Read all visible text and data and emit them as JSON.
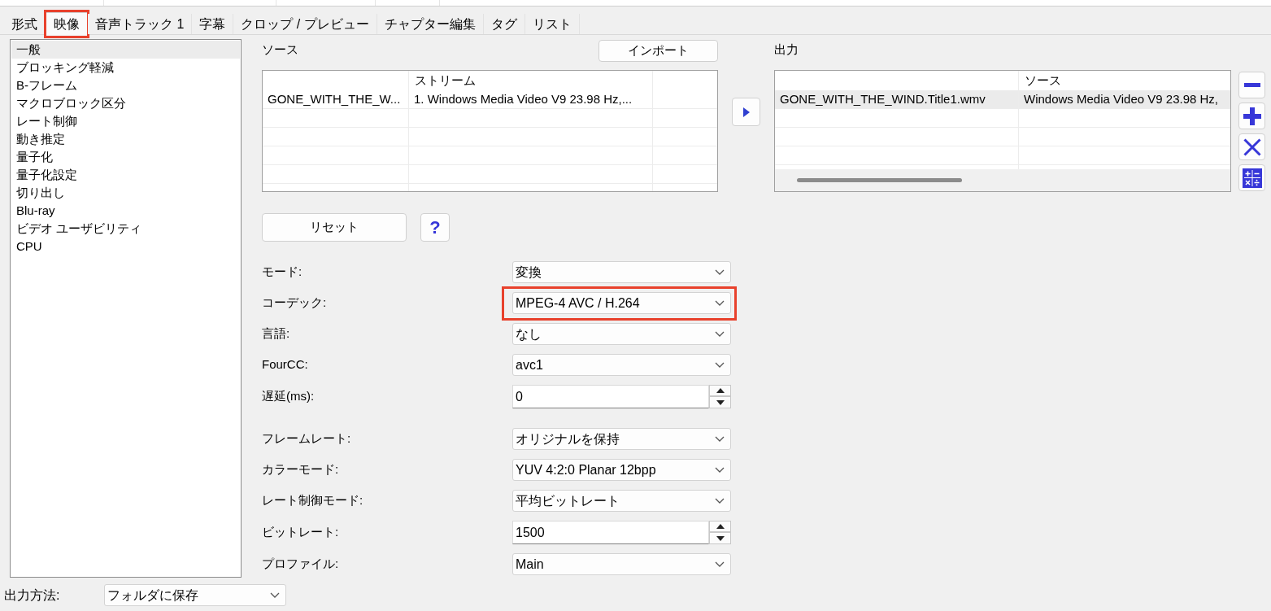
{
  "tabs": [
    {
      "label": "形式",
      "selected": false,
      "highlighted": false
    },
    {
      "label": "映像",
      "selected": true,
      "highlighted": true
    },
    {
      "label": "音声トラック 1",
      "selected": false,
      "highlighted": false
    },
    {
      "label": "字幕",
      "selected": false,
      "highlighted": false
    },
    {
      "label": "クロップ / プレビュー",
      "selected": false,
      "highlighted": false
    },
    {
      "label": "チャプター編集",
      "selected": false,
      "highlighted": false
    },
    {
      "label": "タグ",
      "selected": false,
      "highlighted": false
    },
    {
      "label": "リスト",
      "selected": false,
      "highlighted": false
    }
  ],
  "sidebar": {
    "items": [
      {
        "label": "一般",
        "selected": true
      },
      {
        "label": "ブロッキング軽減",
        "selected": false
      },
      {
        "label": "B-フレーム",
        "selected": false
      },
      {
        "label": "マクロブロック区分",
        "selected": false
      },
      {
        "label": "レート制御",
        "selected": false
      },
      {
        "label": "動き推定",
        "selected": false
      },
      {
        "label": "量子化",
        "selected": false
      },
      {
        "label": "量子化設定",
        "selected": false
      },
      {
        "label": "切り出し",
        "selected": false
      },
      {
        "label": "Blu-ray",
        "selected": false
      },
      {
        "label": "ビデオ ユーザビリティ",
        "selected": false
      },
      {
        "label": "CPU",
        "selected": false
      }
    ]
  },
  "source": {
    "title": "ソース",
    "import_button": "インポート",
    "table": {
      "columns": {
        "column_2": "ストリーム"
      },
      "rows": [
        {
          "column_1": "GONE_WITH_THE_W...",
          "column_2": "1. Windows Media Video V9 23.98 Hz,...",
          "selected": false
        }
      ]
    }
  },
  "output": {
    "title": "出力",
    "table": {
      "columns": {
        "column_2": "ソース"
      },
      "rows": [
        {
          "column_1": "GONE_WITH_THE_WIND.Title1.wmv",
          "column_2": "Windows Media Video V9 23.98 Hz,",
          "selected": true
        }
      ]
    }
  },
  "reset_button": "リセット",
  "help_button": "?",
  "settings": [
    {
      "fields": [
        {
          "kind": "select",
          "label": "モード:",
          "value": "変換",
          "highlighted": false
        },
        {
          "kind": "select",
          "label": "コーデック:",
          "value": "MPEG-4 AVC / H.264",
          "highlighted": true
        },
        {
          "kind": "select",
          "label": "言語:",
          "value": "なし",
          "highlighted": false
        },
        {
          "kind": "select",
          "label": "FourCC:",
          "value": "avc1",
          "highlighted": false
        },
        {
          "kind": "spin",
          "label": "遅延(ms):",
          "value": "0",
          "highlighted": false
        }
      ]
    },
    {
      "fields": [
        {
          "kind": "select",
          "label": "フレームレート:",
          "value": "オリジナルを保持",
          "highlighted": false
        },
        {
          "kind": "select",
          "label": "カラーモード:",
          "value": "YUV 4:2:0 Planar 12bpp",
          "highlighted": false
        },
        {
          "kind": "select",
          "label": "レート制御モード:",
          "value": "平均ビットレート",
          "highlighted": false
        },
        {
          "kind": "spin",
          "label": "ビットレート:",
          "value": "1500",
          "highlighted": false
        },
        {
          "kind": "select",
          "label": "プロファイル:",
          "value": "Main",
          "highlighted": false
        }
      ]
    }
  ],
  "output_method": {
    "label": "出力方法:",
    "value": "フォルダに保存"
  }
}
